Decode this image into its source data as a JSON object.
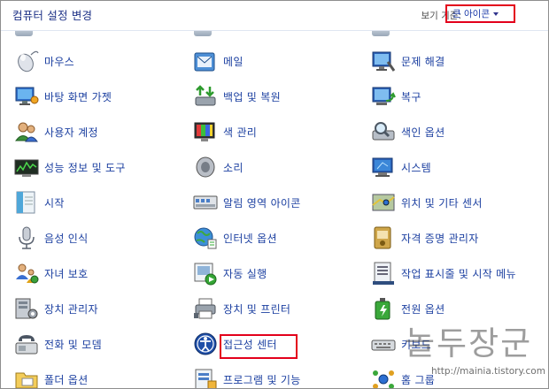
{
  "header": {
    "title": "컴퓨터 설정 변경",
    "view_by_label": "보기 기준:",
    "view_by_value": "큰 아이콘"
  },
  "columns": [
    {
      "items": [
        {
          "label": "마우스",
          "icon": "mouse-icon"
        },
        {
          "label": "바탕 화면 가젯",
          "icon": "desktop-gadgets-icon"
        },
        {
          "label": "사용자 계정",
          "icon": "user-accounts-icon"
        },
        {
          "label": "성능 정보 및 도구",
          "icon": "performance-icon"
        },
        {
          "label": "시작",
          "icon": "getting-started-icon"
        },
        {
          "label": "음성 인식",
          "icon": "microphone-icon"
        },
        {
          "label": "자녀 보호",
          "icon": "parental-controls-icon"
        },
        {
          "label": "장치 관리자",
          "icon": "device-manager-icon"
        },
        {
          "label": "전화 및 모뎀",
          "icon": "phone-modem-icon"
        },
        {
          "label": "폴더 옵션",
          "icon": "folder-options-icon"
        }
      ]
    },
    {
      "items": [
        {
          "label": "메일",
          "icon": "mail-icon"
        },
        {
          "label": "백업 및 복원",
          "icon": "backup-restore-icon"
        },
        {
          "label": "색 관리",
          "icon": "color-management-icon"
        },
        {
          "label": "소리",
          "icon": "speaker-icon"
        },
        {
          "label": "알림 영역 아이콘",
          "icon": "notification-area-icon"
        },
        {
          "label": "인터넷 옵션",
          "icon": "internet-options-icon"
        },
        {
          "label": "자동 실행",
          "icon": "autoplay-icon"
        },
        {
          "label": "장치 및 프린터",
          "icon": "devices-printers-icon"
        },
        {
          "label": "접근성 센터",
          "icon": "ease-of-access-icon"
        },
        {
          "label": "프로그램 및 기능",
          "icon": "programs-features-icon"
        }
      ]
    },
    {
      "items": [
        {
          "label": "문제 해결",
          "icon": "troubleshooting-icon"
        },
        {
          "label": "복구",
          "icon": "recovery-icon"
        },
        {
          "label": "색인 옵션",
          "icon": "indexing-options-icon"
        },
        {
          "label": "시스템",
          "icon": "system-icon"
        },
        {
          "label": "위치 및 기타 센서",
          "icon": "location-sensors-icon"
        },
        {
          "label": "자격 증명 관리자",
          "icon": "credential-manager-icon"
        },
        {
          "label": "작업 표시줄 및 시작 메뉴",
          "icon": "taskbar-start-icon"
        },
        {
          "label": "전원 옵션",
          "icon": "power-options-icon"
        },
        {
          "label": "키보드",
          "icon": "keyboard-icon"
        },
        {
          "label": "홈 그룹",
          "icon": "homegroup-icon"
        }
      ]
    }
  ],
  "highlighted_item": "접근성 센터",
  "watermark": {
    "text": "놀두장군",
    "url": "http://mainia.tistory.com"
  },
  "colors": {
    "title": "#1e3287",
    "link": "#1b3fa0",
    "highlight_border": "#e3001b"
  }
}
